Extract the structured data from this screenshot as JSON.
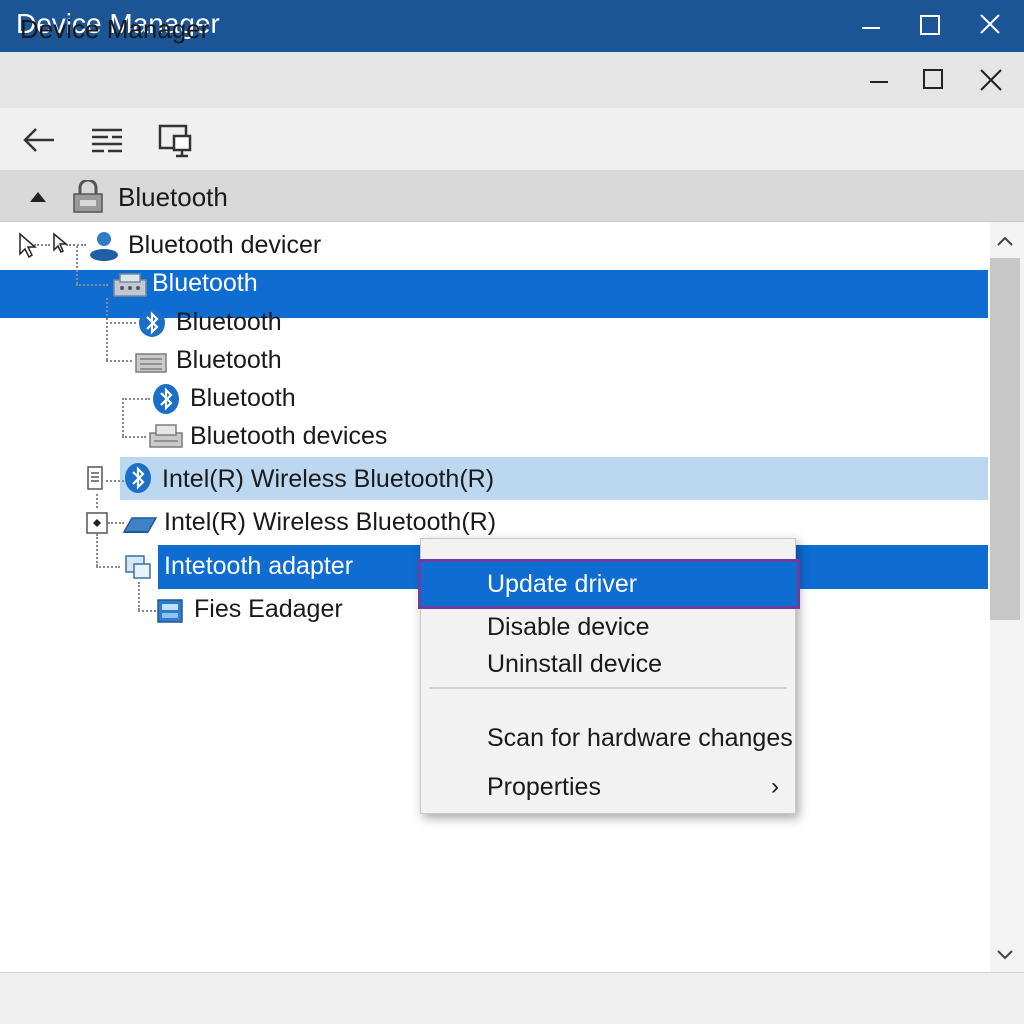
{
  "outer_window": {
    "title": "Device Manager"
  },
  "inner_window": {
    "title": "Device Manager"
  },
  "toolbar": {
    "back_icon": "back-arrow-icon",
    "properties_icon": "properties-list-icon",
    "scan_icon": "scan-monitor-icon"
  },
  "category": {
    "label": "Bluetooth",
    "icon": "bluetooth-category-icon"
  },
  "tree": {
    "items": [
      {
        "label": "Bluetooth devicer"
      },
      {
        "label": "Bluetooth"
      },
      {
        "label": "Bluetooth"
      },
      {
        "label": "Bluetooth"
      },
      {
        "label": "Bluetooth"
      },
      {
        "label": "Bluetooth devices"
      },
      {
        "label": "Intel(R) Wireless Bluetooth(R)"
      },
      {
        "label": "Intel(R) Wireless Bluetooth(R)"
      },
      {
        "label": "Intetooth adapter"
      },
      {
        "label": "Fies Eadager"
      }
    ]
  },
  "context_menu": {
    "items": [
      {
        "label": "Update driver"
      },
      {
        "label": "Disable device"
      },
      {
        "label": "Uninstall device"
      },
      {
        "label": "Scan for hardware changes"
      },
      {
        "label": "Properties"
      }
    ],
    "submenu_arrow": "›"
  },
  "colors": {
    "title_bar": "#1c5596",
    "selection": "#0f6cd1",
    "selection_light": "#bcd7f0",
    "focus_outline": "#6b3fa0"
  }
}
